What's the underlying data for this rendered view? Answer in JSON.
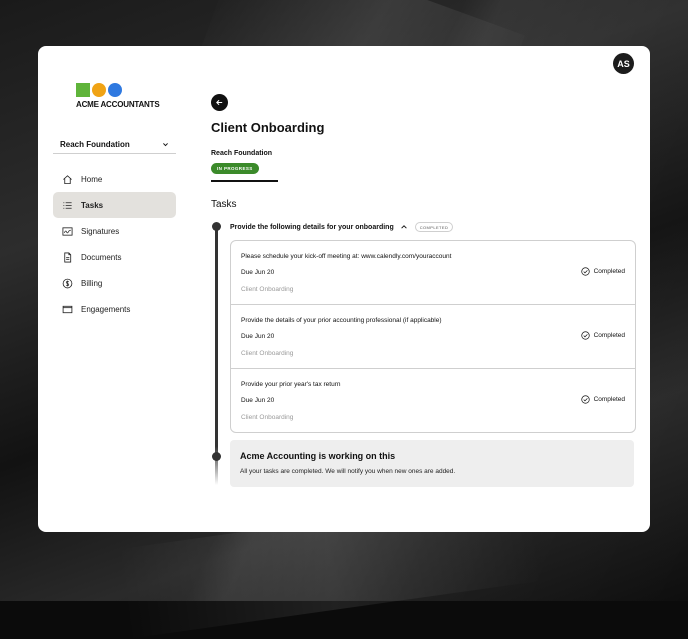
{
  "user": {
    "initials": "AS"
  },
  "brand": {
    "name": "ACME ACCOUNTANTS",
    "colors": {
      "square": "#5fb43a",
      "circle1": "#f0a315",
      "circle2": "#2f79e0"
    }
  },
  "org_selector": {
    "label": "Reach Foundation",
    "icon": "chevron-down-icon"
  },
  "nav": {
    "items": [
      {
        "label": "Home",
        "icon": "home-icon",
        "active": false
      },
      {
        "label": "Tasks",
        "icon": "list-icon",
        "active": true
      },
      {
        "label": "Signatures",
        "icon": "signature-icon",
        "active": false
      },
      {
        "label": "Documents",
        "icon": "document-icon",
        "active": false
      },
      {
        "label": "Billing",
        "icon": "dollar-icon",
        "active": false
      },
      {
        "label": "Engagements",
        "icon": "mail-icon",
        "active": false
      }
    ]
  },
  "page": {
    "title": "Client Onboarding",
    "org_name": "Reach Foundation",
    "status": "IN PROGRESS",
    "status_color": "#3b8a2a"
  },
  "tasks": {
    "heading": "Tasks",
    "group": {
      "title": "Provide the following details for your onboarding",
      "badge": "COMPLETED",
      "items": [
        {
          "title": "Please schedule your kick-off meeting at: www.calendly.com/youraccount",
          "due": "Due Jun 20",
          "category": "Client Onboarding",
          "status": "Completed"
        },
        {
          "title": "Provide the details of your prior accounting professional (if applicable)",
          "due": "Due Jun 20",
          "category": "Client Onboarding",
          "status": "Completed"
        },
        {
          "title": "Provide your prior year's tax return",
          "due": "Due Jun 20",
          "category": "Client Onboarding",
          "status": "Completed"
        }
      ]
    },
    "notice": {
      "title": "Acme Accounting is working on this",
      "body": "All your tasks are completed. We will notify you when new ones are added."
    }
  }
}
